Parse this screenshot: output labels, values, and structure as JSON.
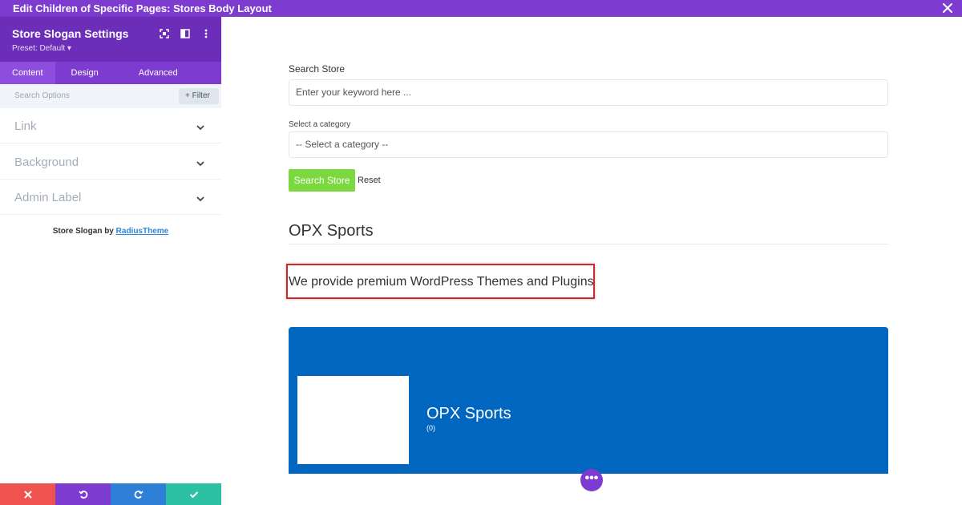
{
  "window": {
    "title": "Edit Children of Specific Pages: Stores Body Layout"
  },
  "panel": {
    "title": "Store Slogan Settings",
    "preset": "Preset: Default ▾",
    "tabs": [
      "Content",
      "Design",
      "Advanced"
    ],
    "active_tab": "Content",
    "search_placeholder": "Search Options",
    "filter_label": "+ Filter",
    "sections": [
      "Link",
      "Background",
      "Admin Label"
    ],
    "credit_prefix": "Store Slogan by ",
    "credit_link": "RadiusTheme"
  },
  "main": {
    "search_label": "Search Store",
    "search_placeholder": "Enter your keyword here ...",
    "category_label": "Select a category",
    "category_selected": "-- Select a category --",
    "search_button": "Search Store",
    "reset_label": "Reset",
    "store_name": "OPX Sports",
    "slogan": "We provide premium WordPress Themes and Plugins",
    "banner_store_name": "OPX Sports",
    "banner_rating": "(0)",
    "fab_label": "•••"
  },
  "colors": {
    "accent_purple": "#7e3bd0",
    "search_button_green": "#7bd83f",
    "banner_blue": "#0066c0",
    "highlight_red": "#d8242b"
  }
}
